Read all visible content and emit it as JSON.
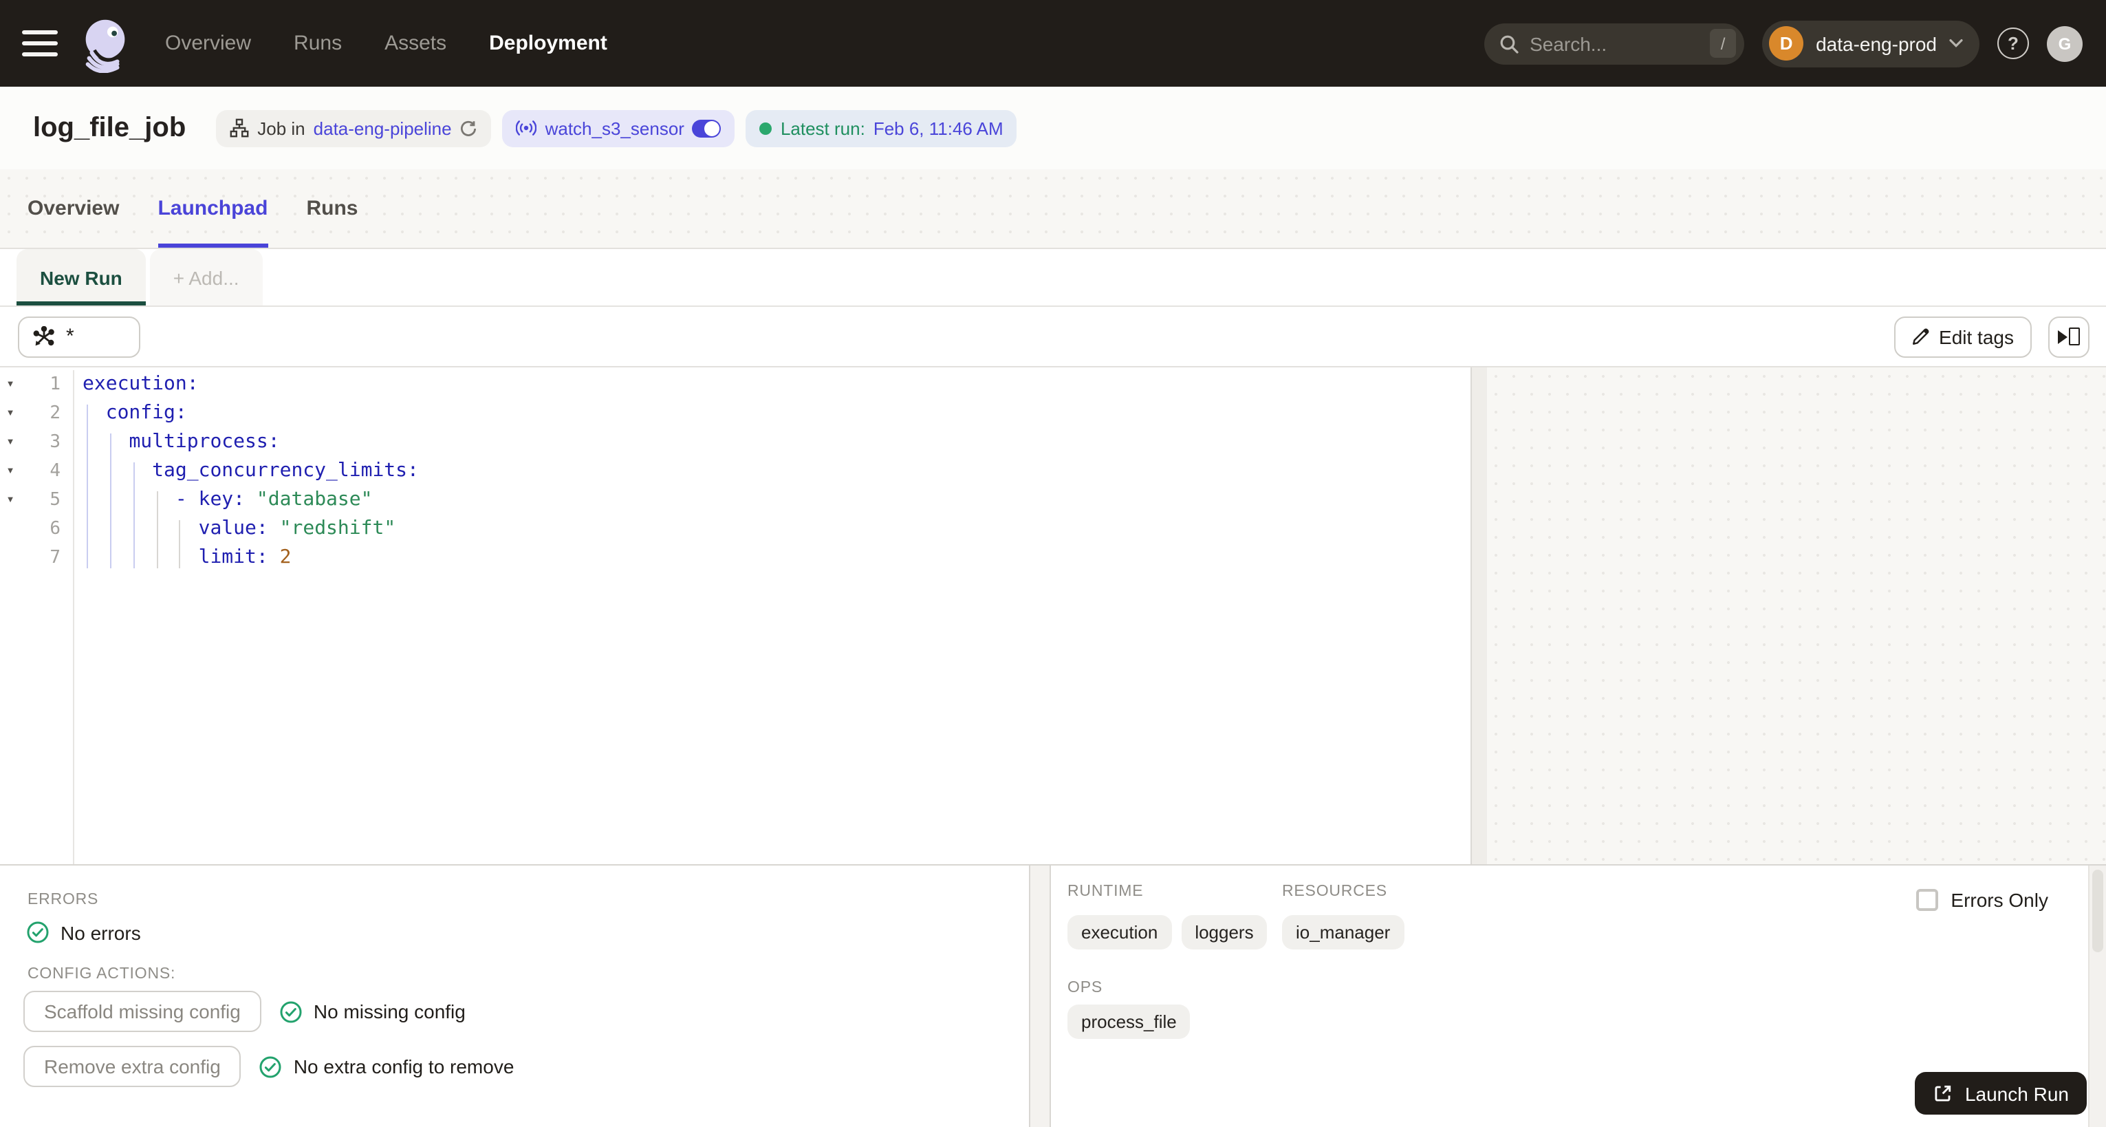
{
  "topbar": {
    "nav": [
      {
        "label": "Overview"
      },
      {
        "label": "Runs"
      },
      {
        "label": "Assets"
      },
      {
        "label": "Deployment"
      }
    ],
    "search": {
      "placeholder": "Search...",
      "shortcut": "/"
    },
    "workspace": {
      "initial": "D",
      "name": "data-eng-prod"
    },
    "avatar_initial": "G"
  },
  "header": {
    "title": "log_file_job",
    "job_badge": {
      "prefix": "Job in",
      "link": "data-eng-pipeline"
    },
    "sensor_badge": {
      "name": "watch_s3_sensor"
    },
    "latest_run_badge": {
      "label": "Latest run:",
      "value": "Feb 6, 11:46 AM"
    }
  },
  "tabs": [
    {
      "label": "Overview"
    },
    {
      "label": "Launchpad"
    },
    {
      "label": "Runs"
    }
  ],
  "session_tabs": {
    "current": "New Run",
    "add": "+ Add..."
  },
  "toolbar": {
    "op_selection": "*",
    "edit_tags_label": "Edit tags"
  },
  "editor": {
    "lines": [
      {
        "num": 1,
        "fold": true,
        "tokens": [
          {
            "c": "k",
            "v": "execution:"
          }
        ]
      },
      {
        "num": 2,
        "fold": true,
        "tokens": [
          {
            "c": "w",
            "v": "  "
          },
          {
            "c": "k",
            "v": "config:"
          }
        ]
      },
      {
        "num": 3,
        "fold": true,
        "tokens": [
          {
            "c": "w",
            "v": "    "
          },
          {
            "c": "k",
            "v": "multiprocess:"
          }
        ]
      },
      {
        "num": 4,
        "fold": true,
        "tokens": [
          {
            "c": "w",
            "v": "      "
          },
          {
            "c": "k",
            "v": "tag_concurrency_limits:"
          }
        ]
      },
      {
        "num": 5,
        "fold": true,
        "tokens": [
          {
            "c": "w",
            "v": "        "
          },
          {
            "c": "k",
            "v": "- key:"
          },
          {
            "c": "w",
            "v": " "
          },
          {
            "c": "s",
            "v": "\"database\""
          }
        ]
      },
      {
        "num": 6,
        "fold": false,
        "tokens": [
          {
            "c": "w",
            "v": "          "
          },
          {
            "c": "k",
            "v": "value:"
          },
          {
            "c": "w",
            "v": " "
          },
          {
            "c": "s",
            "v": "\"redshift\""
          }
        ]
      },
      {
        "num": 7,
        "fold": false,
        "tokens": [
          {
            "c": "w",
            "v": "          "
          },
          {
            "c": "k",
            "v": "limit:"
          },
          {
            "c": "w",
            "v": " "
          },
          {
            "c": "n",
            "v": "2"
          }
        ]
      }
    ],
    "guides": [
      {
        "ch": 0,
        "from": 2,
        "to": 7,
        "color": "blue"
      },
      {
        "ch": 2,
        "from": 3,
        "to": 7,
        "color": "blue"
      },
      {
        "ch": 4,
        "from": 4,
        "to": 7,
        "color": "blue"
      },
      {
        "ch": 6,
        "from": 5,
        "to": 7,
        "color": "gray"
      },
      {
        "ch": 8,
        "from": 6,
        "to": 7,
        "color": "gray"
      }
    ]
  },
  "panel_left": {
    "errors_label": "ERRORS",
    "no_errors": "No errors",
    "config_actions_label": "CONFIG ACTIONS:",
    "actions": [
      {
        "button": "Scaffold missing config",
        "status": "No missing config"
      },
      {
        "button": "Remove extra config",
        "status": "No extra config to remove"
      }
    ]
  },
  "panel_right": {
    "runtime": {
      "label": "RUNTIME",
      "tags": [
        "execution",
        "loggers"
      ]
    },
    "resources": {
      "label": "RESOURCES",
      "tags": [
        "io_manager"
      ]
    },
    "ops": {
      "label": "OPS",
      "tags": [
        "process_file"
      ]
    },
    "errors_only_label": "Errors Only",
    "launch_label": "Launch Run"
  },
  "colors": {
    "nav_bg": "#211d19",
    "accent_link": "#4a45d9",
    "tab_active": "#4a44d8",
    "success_green": "#23a26d",
    "new_run_green": "#1c4f40",
    "workspace_orange": "#d9882b",
    "code_key": "#1f1fb0",
    "code_string": "#2d8a57",
    "code_number": "#a3611e"
  }
}
